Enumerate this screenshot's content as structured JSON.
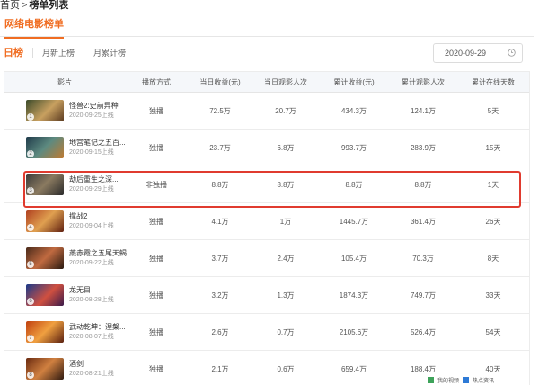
{
  "breadcrumb": {
    "home": "首页",
    "separator": ">",
    "current": "榜单列表"
  },
  "main_tab": "网络电影榜单",
  "subtabs": [
    "日榜",
    "月新上榜",
    "月累计榜"
  ],
  "date_picker": {
    "value": "2020-09-29",
    "icon": "clock-icon"
  },
  "table": {
    "headers": [
      "影片",
      "播放方式",
      "当日收益(元)",
      "当日观影人次",
      "累计收益(元)",
      "累计观影人次",
      "累计在线天数"
    ],
    "rows": [
      {
        "rank": "1",
        "title": "怪兽2:史前异种",
        "release": "2020-09-25上线",
        "mode": "独播",
        "daily_revenue": "72.5万",
        "daily_viewers": "20.7万",
        "total_revenue": "434.3万",
        "total_viewers": "124.1万",
        "days": "5天"
      },
      {
        "rank": "2",
        "title": "地宫笔记之五百...",
        "release": "2020-09-15上线",
        "mode": "独播",
        "daily_revenue": "23.7万",
        "daily_viewers": "6.8万",
        "total_revenue": "993.7万",
        "total_viewers": "283.9万",
        "days": "15天"
      },
      {
        "rank": "3",
        "title": "劫后重生之深...",
        "release": "2020-09-29上线",
        "mode": "非独播",
        "daily_revenue": "8.8万",
        "daily_viewers": "8.8万",
        "total_revenue": "8.8万",
        "total_viewers": "8.8万",
        "days": "1天"
      },
      {
        "rank": "4",
        "title": "撑战2",
        "release": "2020-09-04上线",
        "mode": "独播",
        "daily_revenue": "4.1万",
        "daily_viewers": "1万",
        "total_revenue": "1445.7万",
        "total_viewers": "361.4万",
        "days": "26天"
      },
      {
        "rank": "5",
        "title": "燕赤霞之五尾天蝎",
        "release": "2020-09-22上线",
        "mode": "独播",
        "daily_revenue": "3.7万",
        "daily_viewers": "2.4万",
        "total_revenue": "105.4万",
        "total_viewers": "70.3万",
        "days": "8天"
      },
      {
        "rank": "6",
        "title": "龙无目",
        "release": "2020-08-28上线",
        "mode": "独播",
        "daily_revenue": "3.2万",
        "daily_viewers": "1.3万",
        "total_revenue": "1874.3万",
        "total_viewers": "749.7万",
        "days": "33天"
      },
      {
        "rank": "7",
        "title": "武动乾坤：涅槃...",
        "release": "2020-08-07上线",
        "mode": "独播",
        "daily_revenue": "2.6万",
        "daily_viewers": "0.7万",
        "total_revenue": "2105.6万",
        "total_viewers": "526.4万",
        "days": "54天"
      },
      {
        "rank": "8",
        "title": "酒剑",
        "release": "2020-08-21上线",
        "mode": "独播",
        "daily_revenue": "2.1万",
        "daily_viewers": "0.6万",
        "total_revenue": "659.4万",
        "total_viewers": "188.4万",
        "days": "40天"
      }
    ]
  },
  "footer": {
    "item1": "我的视频",
    "item2": "热点资讯"
  }
}
